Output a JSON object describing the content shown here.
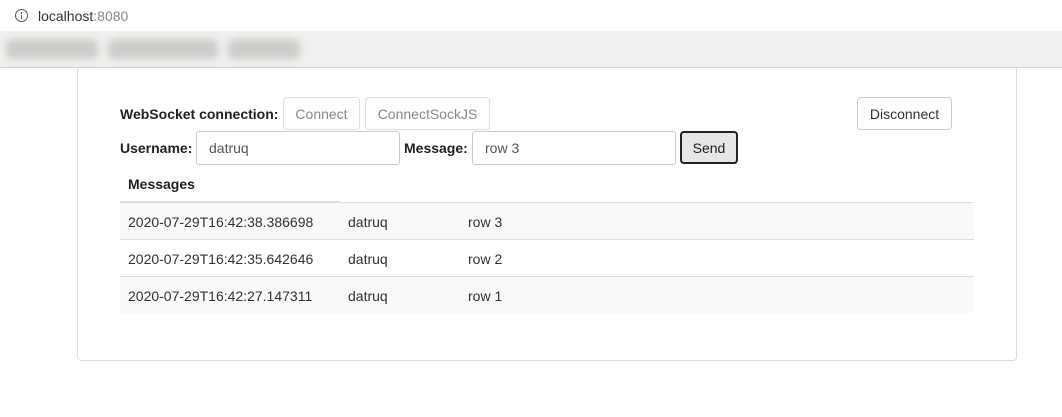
{
  "browser": {
    "url_host": "localhost",
    "url_port": ":8080"
  },
  "form": {
    "connection_label": "WebSocket connection:",
    "connect_label": "Connect",
    "connect_sockjs_label": "ConnectSockJS",
    "disconnect_label": "Disconnect",
    "username_label": "Username:",
    "username_value": "datruq",
    "message_label": "Message:",
    "message_value": "row 3",
    "send_label": "Send"
  },
  "messages": {
    "header": "Messages",
    "rows": [
      {
        "timestamp": "2020-07-29T16:42:38.386698",
        "user": "datruq",
        "text": "row 3"
      },
      {
        "timestamp": "2020-07-29T16:42:35.642646",
        "user": "datruq",
        "text": "row 2"
      },
      {
        "timestamp": "2020-07-29T16:42:27.147311",
        "user": "datruq",
        "text": "row 1"
      }
    ]
  }
}
